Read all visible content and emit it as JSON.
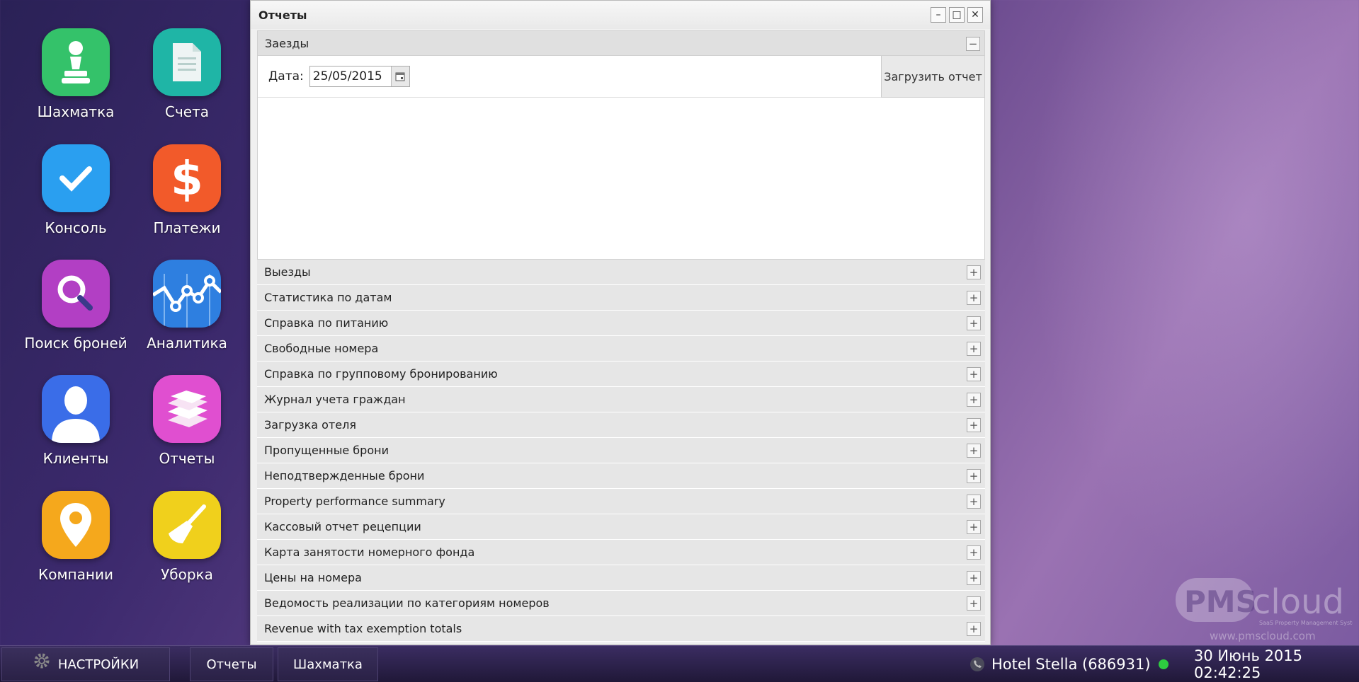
{
  "desktop_icons": [
    {
      "label": "Шахматка",
      "icon": "chess-pawn-icon",
      "color": "#34c26a"
    },
    {
      "label": "Счета",
      "icon": "document-icon",
      "color": "#1fb5a6"
    },
    {
      "label": "Консоль",
      "icon": "checkmark-icon",
      "color": "#2a9ff0"
    },
    {
      "label": "Платежи",
      "icon": "dollar-icon",
      "color": "#f25a2a"
    },
    {
      "label": "Поиск броней",
      "icon": "magnifier-icon",
      "color": "#b23fc4"
    },
    {
      "label": "Аналитика",
      "icon": "line-chart-icon",
      "color": "#2e7fe0"
    },
    {
      "label": "Клиенты",
      "icon": "user-icon",
      "color": "#3a6de8"
    },
    {
      "label": "Отчеты",
      "icon": "books-icon",
      "color": "#e04fd0"
    },
    {
      "label": "Компании",
      "icon": "map-pin-icon",
      "color": "#f5a81c"
    },
    {
      "label": "Уборка",
      "icon": "broom-icon",
      "color": "#f0d01c"
    }
  ],
  "window": {
    "title": "Отчеты",
    "controls": {
      "minimize": "–",
      "maximize": "□",
      "close": "✕"
    }
  },
  "open_section": {
    "title": "Заезды",
    "date_label": "Дата:",
    "date_value": "25/05/2015",
    "load_button": "Загрузить отчет"
  },
  "sections": [
    "Выезды",
    "Статистика по датам",
    "Справка по питанию",
    "Свободные номера",
    "Справка по групповому бронированию",
    "Журнал учета граждан",
    "Загрузка отеля",
    "Пропущенные брони",
    "Неподтвержденные брони",
    "Property performance summary",
    "Кассовый отчет рецепции",
    "Карта занятости номерного фонда",
    "Цены на номера",
    "Ведомость реализации по категориям номеров",
    "Revenue with tax exemption totals"
  ],
  "taskbar": {
    "settings": "НАСТРОЙКИ",
    "tabs": [
      "Отчеты",
      "Шахматка"
    ],
    "hotel": "Hotel Stella (686931)",
    "datetime": "30 Июнь 2015 02:42:25",
    "status_color": "#2ecc40"
  },
  "logo": {
    "brand_pms": "PMS",
    "brand_cloud": "cloud",
    "tagline": "SaaS Property Management System",
    "url": "www.pmscloud.com"
  }
}
